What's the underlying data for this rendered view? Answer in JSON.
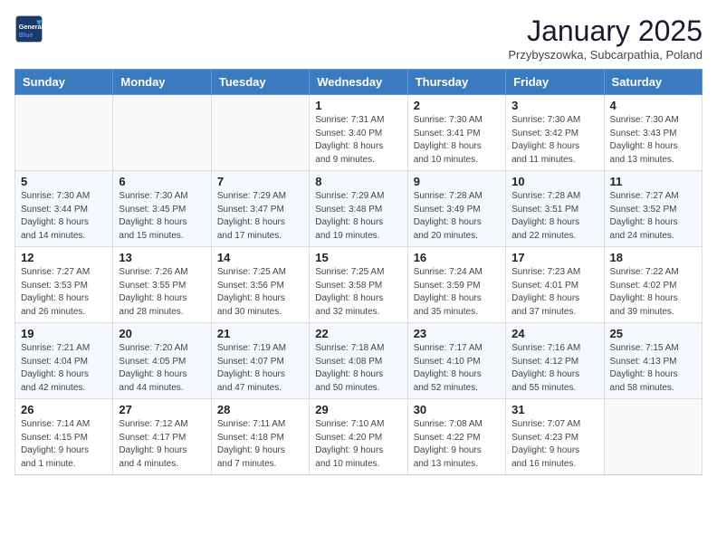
{
  "header": {
    "logo_line1": "General",
    "logo_line2": "Blue",
    "month_title": "January 2025",
    "location": "Przybyszowka, Subcarpathia, Poland"
  },
  "days_of_week": [
    "Sunday",
    "Monday",
    "Tuesday",
    "Wednesday",
    "Thursday",
    "Friday",
    "Saturday"
  ],
  "weeks": [
    [
      {
        "day": "",
        "info": ""
      },
      {
        "day": "",
        "info": ""
      },
      {
        "day": "",
        "info": ""
      },
      {
        "day": "1",
        "info": "Sunrise: 7:31 AM\nSunset: 3:40 PM\nDaylight: 8 hours\nand 9 minutes."
      },
      {
        "day": "2",
        "info": "Sunrise: 7:30 AM\nSunset: 3:41 PM\nDaylight: 8 hours\nand 10 minutes."
      },
      {
        "day": "3",
        "info": "Sunrise: 7:30 AM\nSunset: 3:42 PM\nDaylight: 8 hours\nand 11 minutes."
      },
      {
        "day": "4",
        "info": "Sunrise: 7:30 AM\nSunset: 3:43 PM\nDaylight: 8 hours\nand 13 minutes."
      }
    ],
    [
      {
        "day": "5",
        "info": "Sunrise: 7:30 AM\nSunset: 3:44 PM\nDaylight: 8 hours\nand 14 minutes."
      },
      {
        "day": "6",
        "info": "Sunrise: 7:30 AM\nSunset: 3:45 PM\nDaylight: 8 hours\nand 15 minutes."
      },
      {
        "day": "7",
        "info": "Sunrise: 7:29 AM\nSunset: 3:47 PM\nDaylight: 8 hours\nand 17 minutes."
      },
      {
        "day": "8",
        "info": "Sunrise: 7:29 AM\nSunset: 3:48 PM\nDaylight: 8 hours\nand 19 minutes."
      },
      {
        "day": "9",
        "info": "Sunrise: 7:28 AM\nSunset: 3:49 PM\nDaylight: 8 hours\nand 20 minutes."
      },
      {
        "day": "10",
        "info": "Sunrise: 7:28 AM\nSunset: 3:51 PM\nDaylight: 8 hours\nand 22 minutes."
      },
      {
        "day": "11",
        "info": "Sunrise: 7:27 AM\nSunset: 3:52 PM\nDaylight: 8 hours\nand 24 minutes."
      }
    ],
    [
      {
        "day": "12",
        "info": "Sunrise: 7:27 AM\nSunset: 3:53 PM\nDaylight: 8 hours\nand 26 minutes."
      },
      {
        "day": "13",
        "info": "Sunrise: 7:26 AM\nSunset: 3:55 PM\nDaylight: 8 hours\nand 28 minutes."
      },
      {
        "day": "14",
        "info": "Sunrise: 7:25 AM\nSunset: 3:56 PM\nDaylight: 8 hours\nand 30 minutes."
      },
      {
        "day": "15",
        "info": "Sunrise: 7:25 AM\nSunset: 3:58 PM\nDaylight: 8 hours\nand 32 minutes."
      },
      {
        "day": "16",
        "info": "Sunrise: 7:24 AM\nSunset: 3:59 PM\nDaylight: 8 hours\nand 35 minutes."
      },
      {
        "day": "17",
        "info": "Sunrise: 7:23 AM\nSunset: 4:01 PM\nDaylight: 8 hours\nand 37 minutes."
      },
      {
        "day": "18",
        "info": "Sunrise: 7:22 AM\nSunset: 4:02 PM\nDaylight: 8 hours\nand 39 minutes."
      }
    ],
    [
      {
        "day": "19",
        "info": "Sunrise: 7:21 AM\nSunset: 4:04 PM\nDaylight: 8 hours\nand 42 minutes."
      },
      {
        "day": "20",
        "info": "Sunrise: 7:20 AM\nSunset: 4:05 PM\nDaylight: 8 hours\nand 44 minutes."
      },
      {
        "day": "21",
        "info": "Sunrise: 7:19 AM\nSunset: 4:07 PM\nDaylight: 8 hours\nand 47 minutes."
      },
      {
        "day": "22",
        "info": "Sunrise: 7:18 AM\nSunset: 4:08 PM\nDaylight: 8 hours\nand 50 minutes."
      },
      {
        "day": "23",
        "info": "Sunrise: 7:17 AM\nSunset: 4:10 PM\nDaylight: 8 hours\nand 52 minutes."
      },
      {
        "day": "24",
        "info": "Sunrise: 7:16 AM\nSunset: 4:12 PM\nDaylight: 8 hours\nand 55 minutes."
      },
      {
        "day": "25",
        "info": "Sunrise: 7:15 AM\nSunset: 4:13 PM\nDaylight: 8 hours\nand 58 minutes."
      }
    ],
    [
      {
        "day": "26",
        "info": "Sunrise: 7:14 AM\nSunset: 4:15 PM\nDaylight: 9 hours\nand 1 minute."
      },
      {
        "day": "27",
        "info": "Sunrise: 7:12 AM\nSunset: 4:17 PM\nDaylight: 9 hours\nand 4 minutes."
      },
      {
        "day": "28",
        "info": "Sunrise: 7:11 AM\nSunset: 4:18 PM\nDaylight: 9 hours\nand 7 minutes."
      },
      {
        "day": "29",
        "info": "Sunrise: 7:10 AM\nSunset: 4:20 PM\nDaylight: 9 hours\nand 10 minutes."
      },
      {
        "day": "30",
        "info": "Sunrise: 7:08 AM\nSunset: 4:22 PM\nDaylight: 9 hours\nand 13 minutes."
      },
      {
        "day": "31",
        "info": "Sunrise: 7:07 AM\nSunset: 4:23 PM\nDaylight: 9 hours\nand 16 minutes."
      },
      {
        "day": "",
        "info": ""
      }
    ]
  ]
}
